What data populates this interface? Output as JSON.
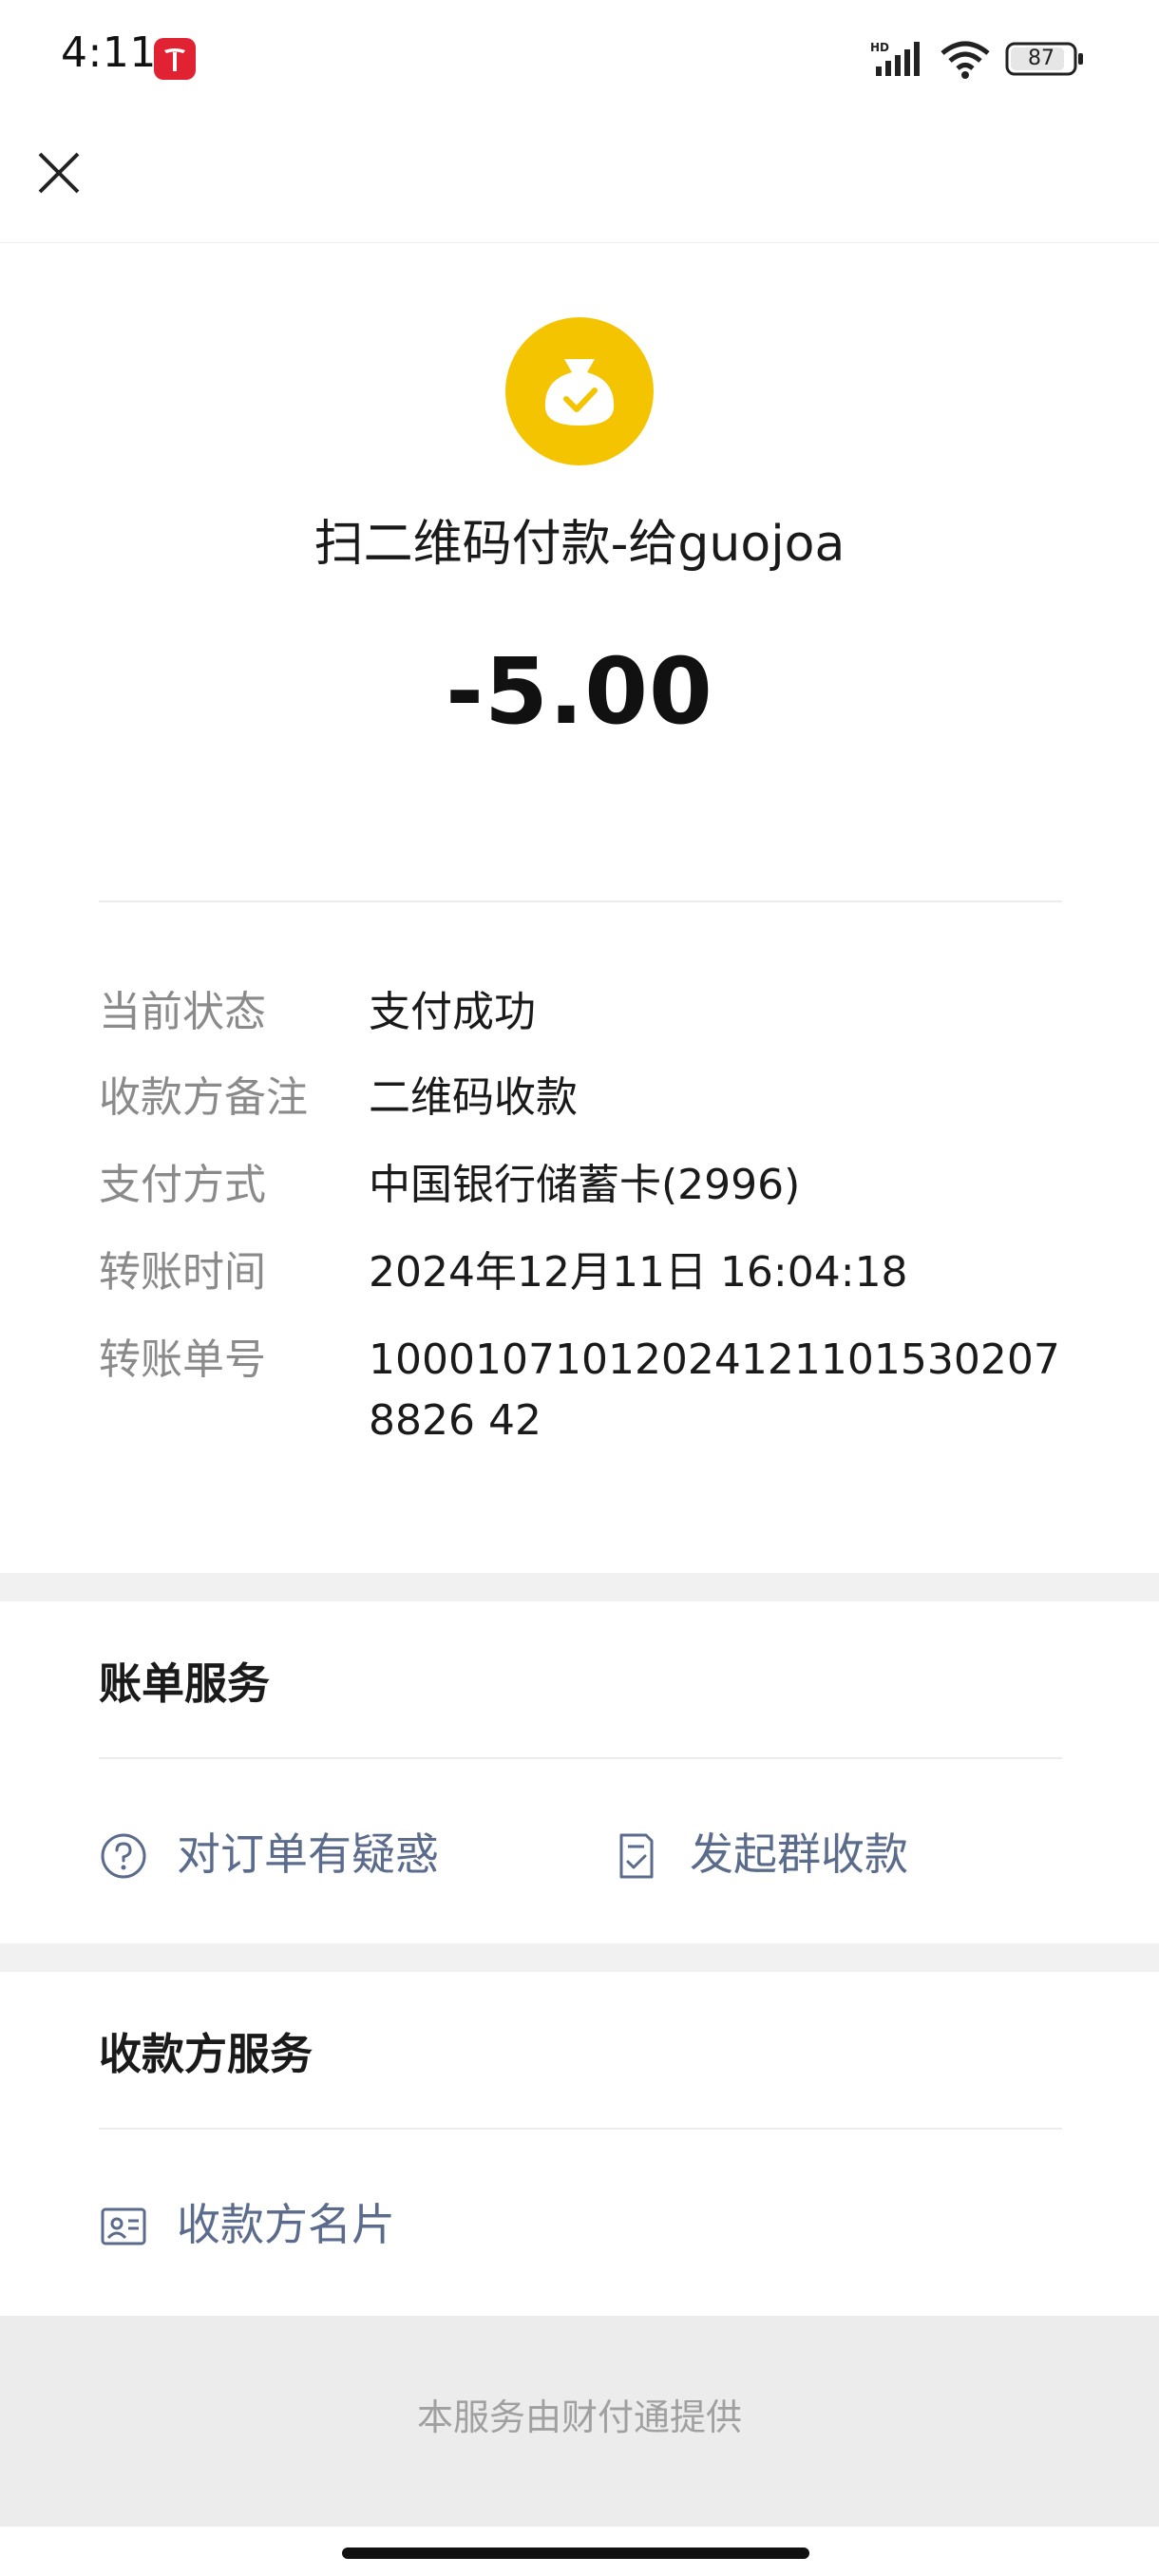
{
  "status_bar": {
    "time": "4:11",
    "battery_level": "87",
    "network_label": "HD"
  },
  "nav": {
    "close_icon": "close-icon"
  },
  "header": {
    "icon": "money-bag-check-icon",
    "icon_color": "#f5c400",
    "title": "扫二维码付款-给guojoa",
    "amount": "-5.00"
  },
  "details": [
    {
      "label": "当前状态",
      "value": "支付成功"
    },
    {
      "label": "收款方备注",
      "value": "二维码收款"
    },
    {
      "label": "支付方式",
      "value": "中国银行储蓄卡(2996)"
    },
    {
      "label": "转账时间",
      "value": "2024年12月11日 16:04:18"
    },
    {
      "label": "转账单号",
      "value": "100010710120241211015302078826 42"
    }
  ],
  "bill_service": {
    "title": "账单服务",
    "items": [
      {
        "icon": "question-circle-icon",
        "label": "对订单有疑惑"
      },
      {
        "icon": "document-check-icon",
        "label": "发起群收款"
      }
    ]
  },
  "payee_service": {
    "title": "收款方服务",
    "items": [
      {
        "icon": "contact-card-icon",
        "label": "收款方名片"
      }
    ]
  },
  "footer": {
    "text": "本服务由财付通提供"
  },
  "colors": {
    "link": "#5b6b8c",
    "label": "#8a8a8a",
    "accent": "#f5c400"
  }
}
